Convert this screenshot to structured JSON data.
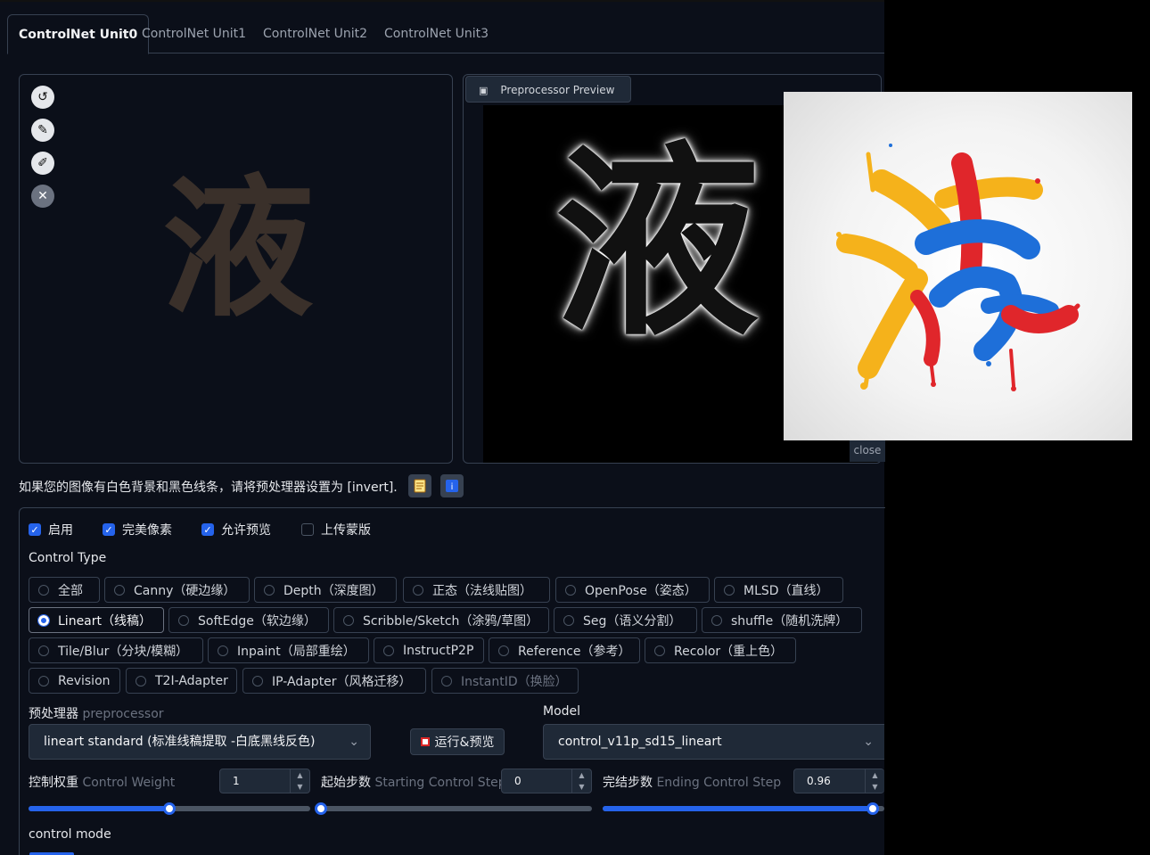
{
  "tabs": [
    "ControlNet Unit0",
    "ControlNet Unit1",
    "ControlNet Unit2",
    "ControlNet Unit3"
  ],
  "upload": {
    "glyph": "液"
  },
  "preview": {
    "label": "Preprocessor Preview",
    "glyph": "液",
    "close": "close"
  },
  "hint": "如果您的图像有白色背景和黑色线条，请将预处理器设置为 [invert].",
  "checks": [
    {
      "label": "启用",
      "checked": true
    },
    {
      "label": "完美像素",
      "checked": true
    },
    {
      "label": "允许预览",
      "checked": true
    },
    {
      "label": "上传蒙版",
      "checked": false
    }
  ],
  "control_type_label": "Control Type",
  "control_types": [
    "全部",
    "Canny（硬边缘）",
    "Depth（深度图）",
    "正态（法线贴图）",
    "OpenPose（姿态）",
    "MLSD（直线）",
    "Lineart（线稿）",
    "SoftEdge（软边缘）",
    "Scribble/Sketch（涂鸦/草图）",
    "Seg（语义分割）",
    "shuffle（随机洗牌）",
    "Tile/Blur（分块/模糊）",
    "Inpaint（局部重绘）",
    "InstructP2P",
    "Reference（参考）",
    "Recolor（重上色）",
    "Revision",
    "T2I-Adapter",
    "IP-Adapter（风格迁移）",
    "InstantID（换脸）"
  ],
  "selected_type": "Lineart（线稿）",
  "preprocessor": {
    "label_zh": "预处理器",
    "label_en": "preprocessor",
    "value": "lineart standard (标准线稿提取 -白底黑线反色)"
  },
  "run_button": "运行&预览",
  "model": {
    "label": "Model",
    "value": "control_v11p_sd15_lineart"
  },
  "weight": {
    "label_zh": "控制权重",
    "label_en": "Control Weight",
    "value": "1",
    "fraction": 0.5
  },
  "start_step": {
    "label_zh": "起始步数",
    "label_en": "Starting Control Step",
    "value": "0",
    "fraction": 0.0
  },
  "end_step": {
    "label_zh": "完结步数",
    "label_en": "Ending Control Step",
    "value": "0.96",
    "fraction": 0.96
  },
  "control_mode_label": "control mode",
  "colors": {
    "accent": "#2563eb",
    "panel_bg": "#0b0f19",
    "border": "#374151"
  },
  "icons": [
    "undo-icon",
    "edit-icon",
    "brush-icon",
    "close-icon",
    "image-icon",
    "document-icon",
    "info-icon",
    "run-icon",
    "chevron-down-icon"
  ]
}
